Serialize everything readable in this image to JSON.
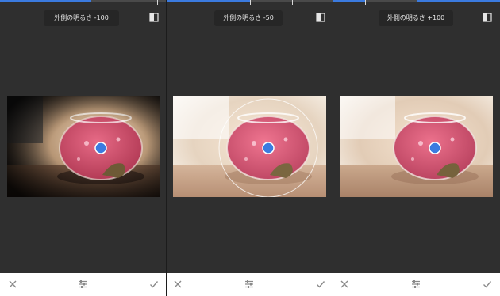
{
  "panels": [
    {
      "adjustment_label": "外側の明るさ -100",
      "outer_brightness_value": -100,
      "icons": {
        "compare": "compare-icon",
        "cancel": "close-icon",
        "tune": "sliders-icon",
        "apply": "check-icon"
      }
    },
    {
      "adjustment_label": "外側の明るさ -50",
      "outer_brightness_value": -50,
      "icons": {
        "compare": "compare-icon",
        "cancel": "close-icon",
        "tune": "sliders-icon",
        "apply": "check-icon"
      }
    },
    {
      "adjustment_label": "外側の明るさ +100",
      "outer_brightness_value": 100,
      "icons": {
        "compare": "compare-icon",
        "cancel": "close-icon",
        "tune": "sliders-icon",
        "apply": "check-icon"
      }
    }
  ],
  "colors": {
    "accent": "#3b7be0",
    "panel_bg": "#2f2f2f",
    "label_pill_bg": "#262626",
    "bottom_bar_bg": "#ffffff"
  }
}
